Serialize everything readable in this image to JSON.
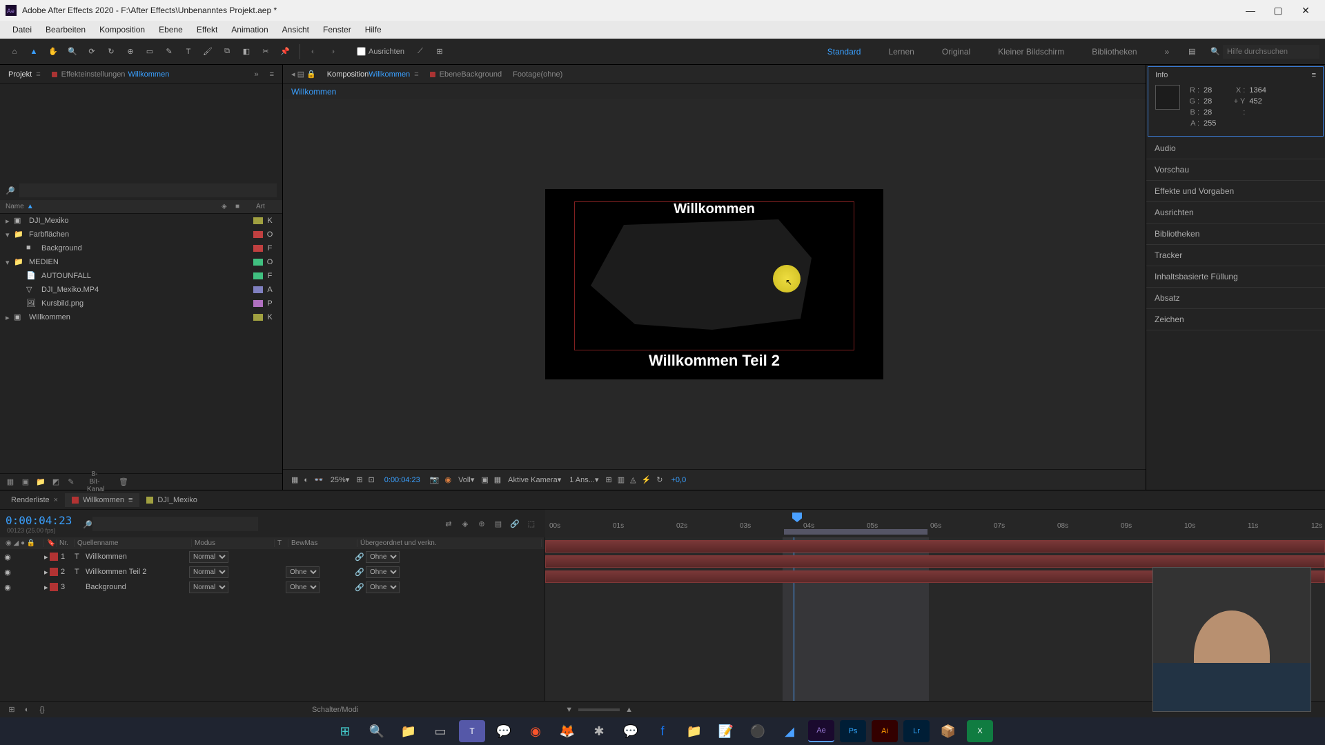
{
  "titlebar": {
    "app": "Adobe After Effects 2020",
    "project_path": "F:\\After Effects\\Unbenanntes Projekt.aep *"
  },
  "menu": [
    "Datei",
    "Bearbeiten",
    "Komposition",
    "Ebene",
    "Effekt",
    "Animation",
    "Ansicht",
    "Fenster",
    "Hilfe"
  ],
  "toolbar": {
    "align_label": "Ausrichten",
    "workspaces": [
      "Standard",
      "Lernen",
      "Original",
      "Kleiner Bildschirm",
      "Bibliotheken"
    ],
    "active_ws": "Standard",
    "search_placeholder": "Hilfe durchsuchen"
  },
  "left_tabs": {
    "projekt": "Projekt",
    "effekt": "Effekteinstellungen",
    "effekt_target": "Willkommen"
  },
  "project": {
    "header_name": "Name",
    "header_art": "Art",
    "items": [
      {
        "name": "DJI_Mexiko",
        "icon": "comp",
        "swatch": "#a0a040",
        "art": "K",
        "indent": 0,
        "twirl": false
      },
      {
        "name": "Farbflächen",
        "icon": "folder",
        "swatch": "#c04040",
        "art": "O",
        "indent": 0,
        "twirl": true
      },
      {
        "name": "Background",
        "icon": "solid",
        "swatch": "#c04040",
        "art": "F",
        "indent": 1,
        "twirl": false
      },
      {
        "name": "MEDIEN",
        "icon": "folder",
        "swatch": "#40c080",
        "art": "O",
        "indent": 0,
        "twirl": true
      },
      {
        "name": "AUTOUNFALL",
        "icon": "file",
        "swatch": "#40c080",
        "art": "F",
        "indent": 1,
        "twirl": false
      },
      {
        "name": "DJI_Mexiko.MP4",
        "icon": "video",
        "swatch": "#8080c0",
        "art": "A",
        "indent": 1,
        "twirl": false
      },
      {
        "name": "Kursbild.png",
        "icon": "image",
        "swatch": "#b070c0",
        "art": "P",
        "indent": 1,
        "twirl": false
      },
      {
        "name": "Willkommen",
        "icon": "comp",
        "swatch": "#a0a040",
        "art": "K",
        "indent": 0,
        "twirl": false
      }
    ],
    "bit_depth": "8-Bit-Kanal"
  },
  "comp_tabs": {
    "comp_label": "Komposition",
    "comp_name": "Willkommen",
    "layer_label": "Ebene",
    "layer_name": "Background",
    "footage_label": "Footage",
    "footage_name": "(ohne)"
  },
  "breadcrumb": "Willkommen",
  "canvas": {
    "title1": "Willkommen",
    "title2": "Willkommen Teil 2"
  },
  "viewbar": {
    "zoom": "25%",
    "timecode": "0:00:04:23",
    "res": "Voll",
    "camera": "Aktive Kamera",
    "views": "1 Ans...",
    "exposure": "+0,0"
  },
  "info": {
    "title": "Info",
    "R": "28",
    "G": "28",
    "B": "28",
    "A": "255",
    "X": "1364",
    "Y": "452"
  },
  "right_panels": [
    "Audio",
    "Vorschau",
    "Effekte und Vorgaben",
    "Ausrichten",
    "Bibliotheken",
    "Tracker",
    "Inhaltsbasierte Füllung",
    "Absatz",
    "Zeichen"
  ],
  "timeline": {
    "tabs": {
      "render": "Renderliste",
      "active": "Willkommen",
      "other": "DJI_Mexiko"
    },
    "timecode": "0:00:04:23",
    "sub": "00123 (25.00 fps)",
    "columns": {
      "nr": "Nr.",
      "quelle": "Quellenname",
      "modus": "Modus",
      "t": "T",
      "bewmas": "BewMas",
      "uber": "Übergeordnet und verkn."
    },
    "ruler_ticks": [
      "00s",
      "01s",
      "02s",
      "03s",
      "04s",
      "05s",
      "06s",
      "07s",
      "08s",
      "09s",
      "10s",
      "11s",
      "12s"
    ],
    "layers": [
      {
        "nr": "1",
        "name": "Willkommen",
        "type": "T",
        "mode": "Normal",
        "bew": "",
        "parent": "Ohne",
        "color": "#b23333"
      },
      {
        "nr": "2",
        "name": "Willkommen Teil 2",
        "type": "T",
        "mode": "Normal",
        "bew": "Ohne",
        "parent": "Ohne",
        "color": "#b23333"
      },
      {
        "nr": "3",
        "name": "Background",
        "type": "",
        "mode": "Normal",
        "bew": "Ohne",
        "parent": "Ohne",
        "color": "#b23333"
      }
    ],
    "schalter": "Schalter/Modi"
  }
}
